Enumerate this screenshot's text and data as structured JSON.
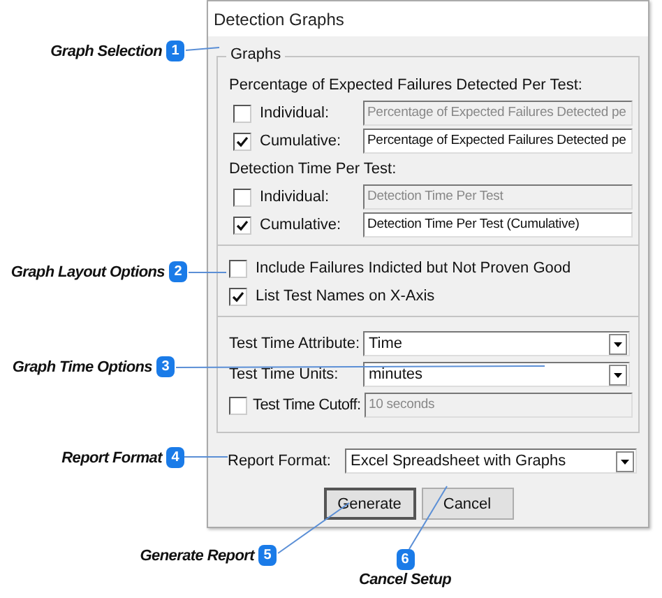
{
  "window": {
    "title": "Detection Graphs"
  },
  "graphs": {
    "title": "Graphs",
    "sections": [
      {
        "heading": "Percentage of Expected Failures Detected Per Test:",
        "rows": [
          {
            "label": "Individual:",
            "checked": false,
            "disabled": true,
            "value": "Percentage of Expected Failures Detected pe"
          },
          {
            "label": "Cumulative:",
            "checked": true,
            "disabled": false,
            "value": "Percentage of Expected Failures Detected pe"
          }
        ]
      },
      {
        "heading": "Detection Time Per Test:",
        "rows": [
          {
            "label": "Individual:",
            "checked": false,
            "disabled": true,
            "value": "Detection Time Per Test"
          },
          {
            "label": "Cumulative:",
            "checked": true,
            "disabled": false,
            "value": "Detection Time Per Test (Cumulative)"
          }
        ]
      }
    ]
  },
  "layout_options": [
    {
      "label": "Include Failures Indicted but Not Proven Good",
      "checked": false
    },
    {
      "label": "List Test Names on X-Axis",
      "checked": true
    }
  ],
  "time_options": {
    "attribute": {
      "label": "Test Time Attribute:",
      "value": "Time"
    },
    "units": {
      "label": "Test Time Units:",
      "value": "minutes"
    },
    "cutoff": {
      "label": "Test Time Cutoff:",
      "checked": false,
      "disabled": true,
      "value": "10 seconds"
    }
  },
  "report_format": {
    "label": "Report Format:",
    "value": "Excel Spreadsheet with Graphs"
  },
  "buttons": [
    {
      "label": "Generate",
      "default": true
    },
    {
      "label": "Cancel",
      "default": false
    }
  ],
  "callouts": [
    {
      "number": "1",
      "text": "Graph Selection"
    },
    {
      "number": "2",
      "text": "Graph Layout Options"
    },
    {
      "number": "3",
      "text": "Graph Time Options"
    },
    {
      "number": "4",
      "text": "Report Format"
    },
    {
      "number": "5",
      "text": "Generate Report"
    },
    {
      "number": "6",
      "text": "Cancel Setup"
    }
  ]
}
